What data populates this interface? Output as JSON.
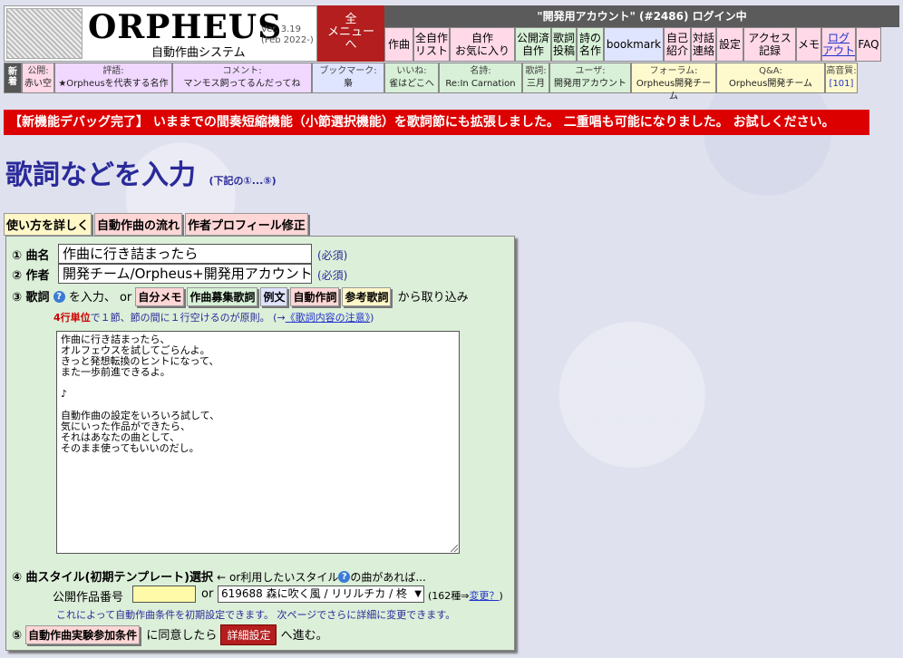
{
  "header": {
    "logo_title": "ORPHEUS",
    "logo_subtitle": "自動作曲システム",
    "version": "Ver. 3.19",
    "version_date": "(Feb 2022-)",
    "all_menu": "全\nメニュー\nへ",
    "login_status": "\"開発用アカウント\" (#2486) ログイン中",
    "nav": [
      {
        "label": "作曲",
        "style": "p"
      },
      {
        "label": "全自作\nリスト",
        "style": "p"
      },
      {
        "label": "自作\nお気に入り",
        "style": "p"
      },
      {
        "label": "公開済\n自作",
        "style": "g"
      },
      {
        "label": "歌詞\n投稿",
        "style": "g"
      },
      {
        "label": "詩の\n名作",
        "style": "g"
      },
      {
        "label": "bookmark",
        "style": "b"
      },
      {
        "label": "自己\n紹介",
        "style": "p"
      },
      {
        "label": "対話\n連絡",
        "style": "p"
      },
      {
        "label": "設定",
        "style": "p"
      },
      {
        "label": "アクセス\n記録",
        "style": "p"
      },
      {
        "label": "メモ",
        "style": "p"
      },
      {
        "label": "ログ\nアウト",
        "style": "link"
      },
      {
        "label": "FAQ",
        "style": "p"
      }
    ],
    "new_tag": "新\n着",
    "info": [
      {
        "label": "公開:",
        "value": "赤い空",
        "bg": "#ffd9e8"
      },
      {
        "label": "評語:",
        "value": "★Orpheusを代表する名作",
        "bg": "#f0d8ff"
      },
      {
        "label": "コメント:",
        "value": "マンモス飼ってるんだってね",
        "bg": "#f0d8ff"
      },
      {
        "label": "ブックマーク:",
        "value": "梟",
        "bg": "#dfe4ff"
      },
      {
        "label": "いいね:",
        "value": "雀はどこへ",
        "bg": "#d7f0d7"
      },
      {
        "label": "名詩:",
        "value": "Re:In Carnation",
        "bg": "#d7f0d7"
      },
      {
        "label": "歌詞:",
        "value": "三月",
        "bg": "#d7f0d7"
      },
      {
        "label": "ユーザ:",
        "value": "開発用アカウント",
        "bg": "#d7f0d7"
      },
      {
        "label": "フォーラム:",
        "value": "Orpheus開発チーム",
        "bg": "#fffacd"
      },
      {
        "label": "Q&A:",
        "value": "Orpheus開発チーム",
        "bg": "#fffacd"
      },
      {
        "label": "高音質:",
        "value": "[101]",
        "bg": "#fffacd"
      }
    ]
  },
  "notice": "【新機能デバッグ完了】 いままでの間奏短縮機能（小節選択機能）を歌詞節にも拡張しました。 二重唱も可能になりました。 お試しください。",
  "page": {
    "title": "歌詞などを入力",
    "title_sub": "(下記の①...⑤)"
  },
  "top_buttons": {
    "howto": "使い方を詳しく",
    "flow": "自動作曲の流れ",
    "profile": "作者プロフィール修正"
  },
  "form": {
    "title_label": "① 曲名",
    "title_value": "作曲に行き詰まったら",
    "required": "(必須)",
    "author_label": "② 作者",
    "author_value": "開発チーム/Orpheus+開発用アカウント",
    "lyrics_label": "③ 歌詞",
    "lyrics_input_text": "を入力、 or",
    "lyrics_sources": [
      "自分メモ",
      "作曲募集歌詞",
      "例文",
      "自動作詞",
      "参考歌詞"
    ],
    "lyrics_suffix": "から取り込み",
    "lyrics_rule_red": "4行単位",
    "lyrics_rule_text": "で１節、節の間に１行空けるのが原則。 (→",
    "lyrics_rule_link": "《歌詞内容の注意》",
    "lyrics_rule_end": ")",
    "lyrics_text": "作曲に行き詰まったら、\nオルフェウスを試してごらんよ。\nきっと発想転換のヒントになって、\nまた一歩前進できるよ。\n\n♪\n\n自動作曲の設定をいろいろ試して、\n気にいった作品ができたら、\nそれはあなたの曲として、\nそのまま使ってもいいのだし。",
    "style_label": "④ 曲スタイル(初期テンプレート)選択",
    "style_hint_pre": "← or利用したいスタイル",
    "style_hint_post": "の曲があれば...",
    "pub_num_label": "公開作品番号",
    "or": "or",
    "style_selected": "619688 森に吹く風 / リリルチカ / 柊",
    "style_count_pre": "(162種⇒",
    "style_count_link": "変更？",
    "style_count_post": ")",
    "style_note": "これによって自動作曲条件を初期設定できます。 次ページでさらに詳細に変更できます。",
    "agree_label": "⑤",
    "agree_button": "自動作曲実験参加条件",
    "agree_text": "に同意したら",
    "detail_button": "詳細設定",
    "proceed": "へ進む。"
  }
}
